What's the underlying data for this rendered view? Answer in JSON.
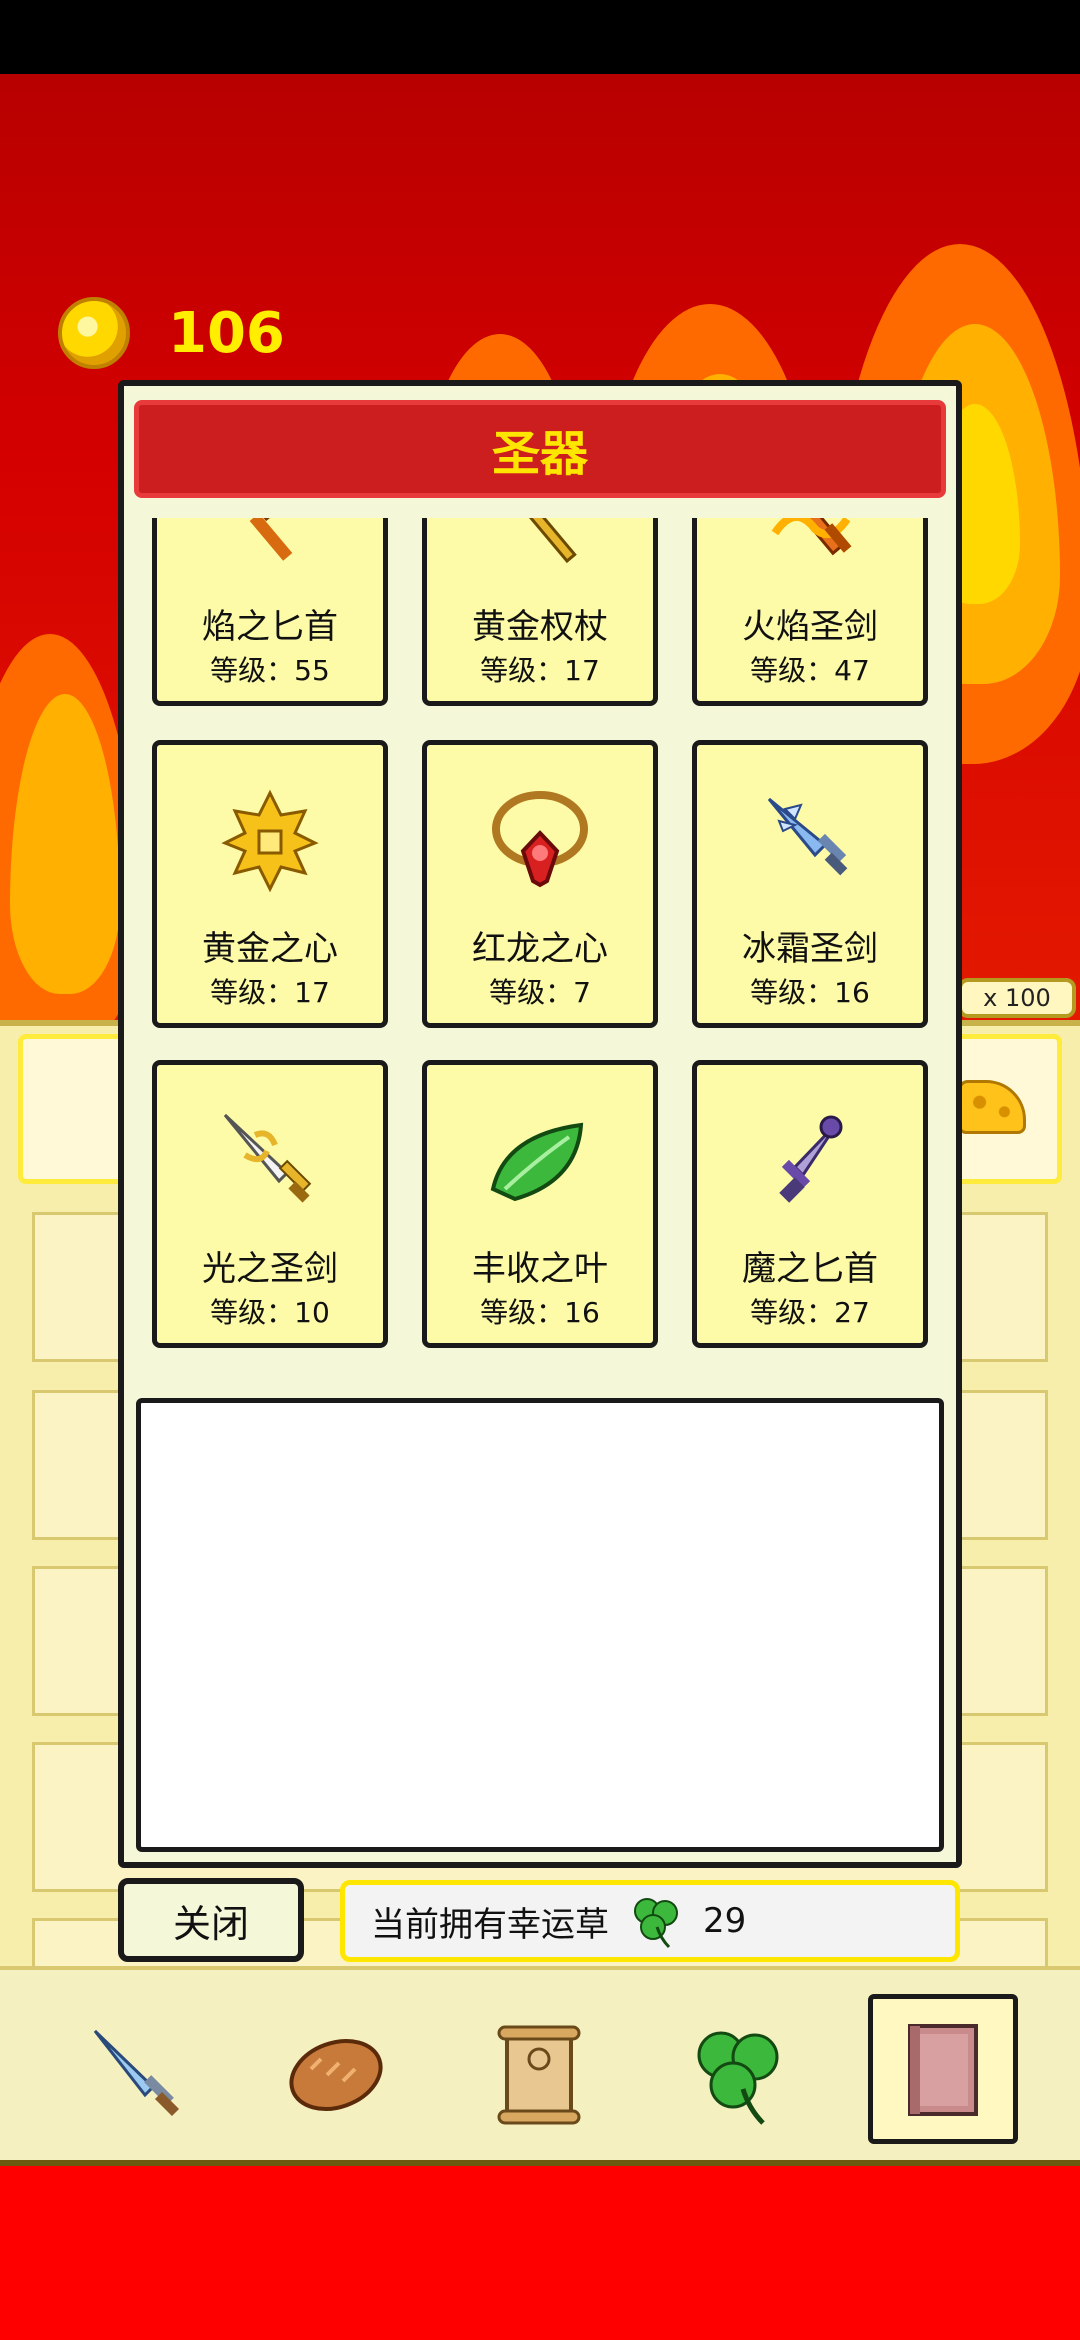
{
  "currency": {
    "icon": "gold-coin-icon",
    "amount": "106"
  },
  "modal": {
    "title": "圣器",
    "items": [
      {
        "name": "焰之匕首",
        "level": "等级：55",
        "icon": "flame-dagger-icon"
      },
      {
        "name": "黄金权杖",
        "level": "等级：17",
        "icon": "golden-scepter-icon"
      },
      {
        "name": "火焰圣剑",
        "level": "等级：47",
        "icon": "flame-holy-sword-icon"
      },
      {
        "name": "黄金之心",
        "level": "等级：17",
        "icon": "golden-heart-icon"
      },
      {
        "name": "红龙之心",
        "level": "等级：7",
        "icon": "red-dragon-heart-icon"
      },
      {
        "name": "冰霜圣剑",
        "level": "等级：16",
        "icon": "frost-holy-sword-icon"
      },
      {
        "name": "光之圣剑",
        "level": "等级：10",
        "icon": "light-holy-sword-icon"
      },
      {
        "name": "丰收之叶",
        "level": "等级：16",
        "icon": "harvest-leaf-icon"
      },
      {
        "name": "魔之匕首",
        "level": "等级：27",
        "icon": "demon-dagger-icon"
      }
    ],
    "description": ""
  },
  "close_label": "关闭",
  "luck": {
    "label": "当前拥有幸运草",
    "icon": "clover-icon",
    "count": "29"
  },
  "background": {
    "multiplier": "x 100"
  },
  "nav": [
    {
      "icon": "sword-icon",
      "active": false
    },
    {
      "icon": "bread-icon",
      "active": false
    },
    {
      "icon": "scroll-icon",
      "active": false
    },
    {
      "icon": "clover-icon",
      "active": false
    },
    {
      "icon": "book-icon",
      "active": true
    }
  ],
  "colors": {
    "title_bar": "#cc1e1e",
    "title_text": "#ffe600",
    "card_bg": "#fdfba8",
    "coin_text": "#ffee00"
  }
}
